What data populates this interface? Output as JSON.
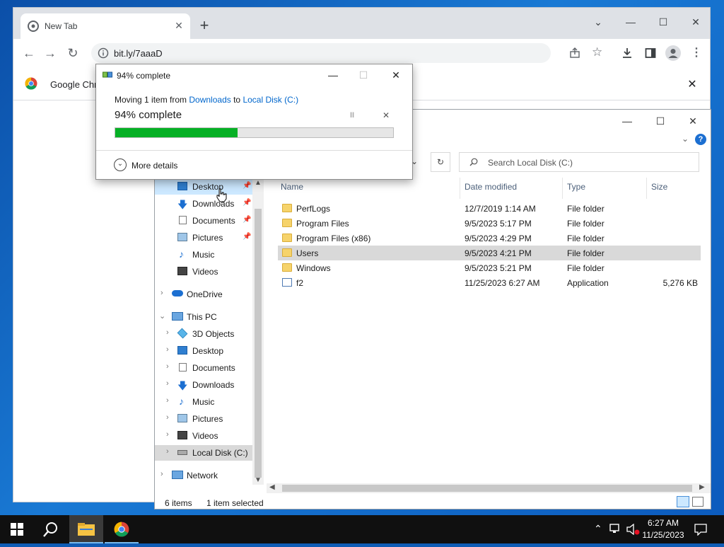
{
  "browser": {
    "tab_title": "New Tab",
    "tab_close": "✕",
    "new_tab": "+",
    "url": "bit.ly/7aaaD",
    "bubble_text": "Google Chr",
    "bubble_close": "✕",
    "window_controls": {
      "collapse": "⌄",
      "minimize": "—",
      "maximize": "☐",
      "close": "✕"
    }
  },
  "explorer": {
    "search_placeholder": "Search Local Disk (C:)",
    "columns": [
      "Name",
      "Date modified",
      "Type",
      "Size"
    ],
    "quick_access": [
      {
        "label": "Desktop",
        "icon": "desktop-icon"
      },
      {
        "label": "Downloads",
        "icon": "download-icon"
      },
      {
        "label": "Documents",
        "icon": "document-icon"
      },
      {
        "label": "Pictures",
        "icon": "pictures-icon"
      },
      {
        "label": "Music",
        "icon": "music-icon"
      },
      {
        "label": "Videos",
        "icon": "video-icon"
      }
    ],
    "onedrive": "OneDrive",
    "this_pc": "This PC",
    "this_pc_items": [
      {
        "label": "3D Objects",
        "icon": "3d-objects-icon"
      },
      {
        "label": "Desktop",
        "icon": "desktop-icon"
      },
      {
        "label": "Documents",
        "icon": "document-icon"
      },
      {
        "label": "Downloads",
        "icon": "download-icon"
      },
      {
        "label": "Music",
        "icon": "music-icon"
      },
      {
        "label": "Pictures",
        "icon": "pictures-icon"
      },
      {
        "label": "Videos",
        "icon": "video-icon"
      },
      {
        "label": "Local Disk (C:)",
        "icon": "drive-icon"
      }
    ],
    "network": "Network",
    "files": [
      {
        "name": "PerfLogs",
        "date": "12/7/2019 1:14 AM",
        "type": "File folder",
        "size": "",
        "kind": "folder"
      },
      {
        "name": "Program Files",
        "date": "9/5/2023 5:17 PM",
        "type": "File folder",
        "size": "",
        "kind": "folder"
      },
      {
        "name": "Program Files (x86)",
        "date": "9/5/2023 4:29 PM",
        "type": "File folder",
        "size": "",
        "kind": "folder"
      },
      {
        "name": "Users",
        "date": "9/5/2023 4:21 PM",
        "type": "File folder",
        "size": "",
        "kind": "folder"
      },
      {
        "name": "Windows",
        "date": "9/5/2023 5:21 PM",
        "type": "File folder",
        "size": "",
        "kind": "folder"
      },
      {
        "name": "f2",
        "date": "11/25/2023 6:27 AM",
        "type": "Application",
        "size": "5,276 KB",
        "kind": "app"
      }
    ],
    "status_items": "6 items",
    "status_selected": "1 item selected"
  },
  "dialog": {
    "title": "94% complete",
    "moving_prefix": "Moving 1 item from ",
    "from": "Downloads",
    "to_word": " to ",
    "to": "Local Disk (C:)",
    "percent_text": "94% complete",
    "progress": 0.44,
    "more_details": "More details",
    "pause": "II",
    "cancel": "✕"
  },
  "taskbar": {
    "time": "6:27 AM",
    "date": "11/25/2023"
  }
}
